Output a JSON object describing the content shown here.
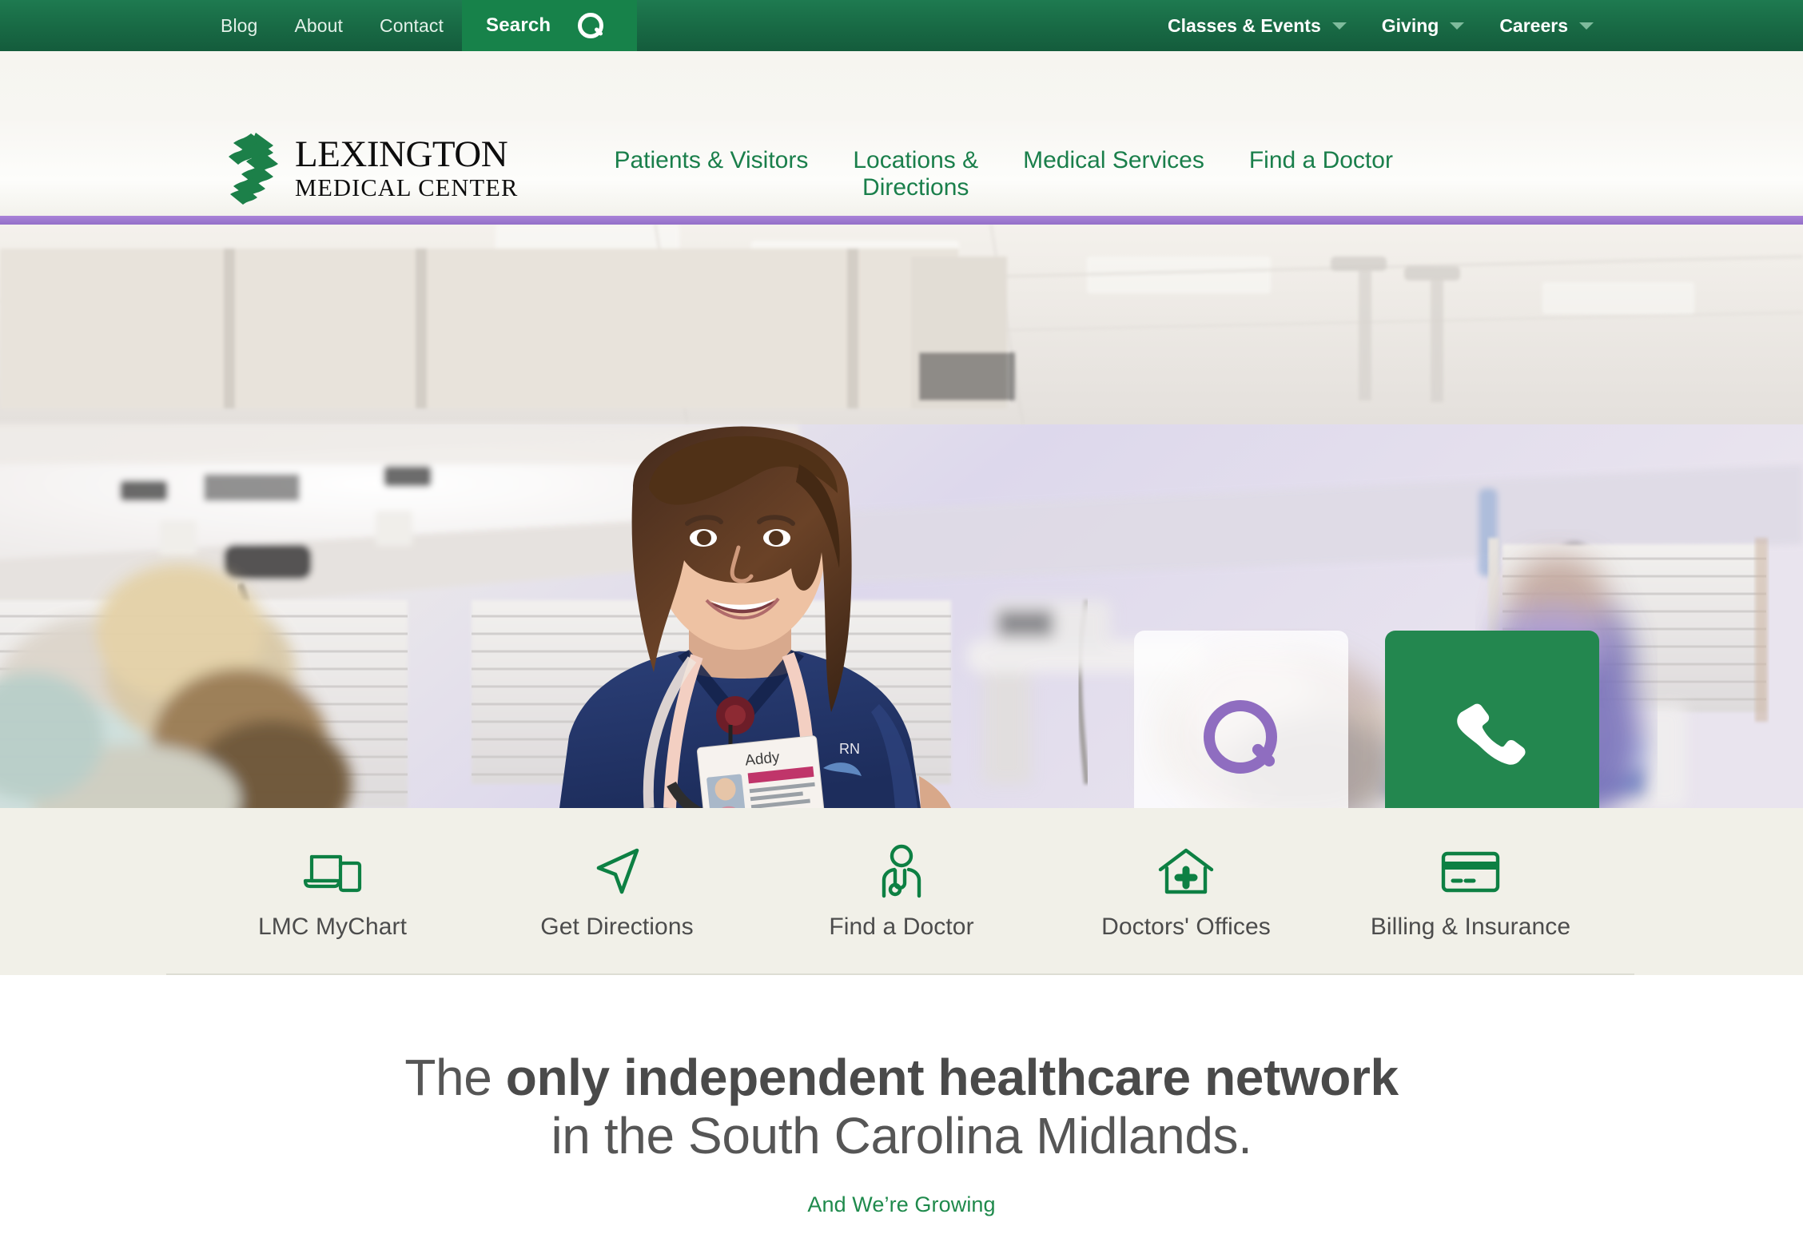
{
  "topbar": {
    "links": [
      {
        "label": "Blog"
      },
      {
        "label": "About"
      },
      {
        "label": "Contact"
      }
    ],
    "search": {
      "label": "Search",
      "icon": "search-icon"
    },
    "right_links": [
      {
        "label": "Classes & Events",
        "icon": "chevron-down-icon"
      },
      {
        "label": "Giving",
        "icon": "chevron-down-icon"
      },
      {
        "label": "Careers",
        "icon": "chevron-down-icon"
      }
    ],
    "colors": {
      "background": "#186944",
      "search_background": "#17824a",
      "caret": "#7ebb9c"
    }
  },
  "header": {
    "brand": {
      "line1": "LEXINGTON",
      "line2": "MEDICAL CENTER",
      "logo_icon": "lexington-diamond-logo-icon"
    },
    "nav": [
      {
        "label": "Patients & Visitors"
      },
      {
        "label": "Locations &\nDirections"
      },
      {
        "label": "Medical Services"
      },
      {
        "label": "Find a Doctor"
      }
    ],
    "colors": {
      "nav_link": "#1a7f4b",
      "background": "#f6f5f0",
      "accent_rule": "#9b72d0"
    }
  },
  "hero": {
    "alt": "Smiling nurse in blue scrubs with stethoscope in a hospital room",
    "tiles": [
      {
        "name": "hero-search-tile",
        "icon": "search-icon",
        "style": "light"
      },
      {
        "name": "hero-phone-tile",
        "icon": "phone-icon",
        "style": "green"
      }
    ],
    "badge_name": "Addy",
    "badge_credential": "RN",
    "colors": {
      "search_tile": "rgba(255,255,255,0.80)",
      "search_glyph": "#8f6dc0",
      "phone_tile": "#23874f"
    }
  },
  "quicklinks": {
    "items": [
      {
        "label": "LMC MyChart",
        "icon": "laptop-phone-icon"
      },
      {
        "label": "Get Directions",
        "icon": "navigation-arrow-icon"
      },
      {
        "label": "Find a Doctor",
        "icon": "doctor-stethoscope-icon"
      },
      {
        "label": "Doctors' Offices",
        "icon": "house-cross-icon"
      },
      {
        "label": "Billing & Insurance",
        "icon": "credit-card-icon"
      }
    ],
    "colors": {
      "background": "#f1f0e8",
      "icon": "#0d8043",
      "label": "#4c4c4c"
    }
  },
  "promo": {
    "headline_prefix": "The ",
    "headline_bold": "only independent healthcare network",
    "headline_line2": "in the South Carolina Midlands.",
    "subhead": "And We’re Growing",
    "colors": {
      "headline": "#565656",
      "subhead": "#1f8a4c"
    }
  }
}
